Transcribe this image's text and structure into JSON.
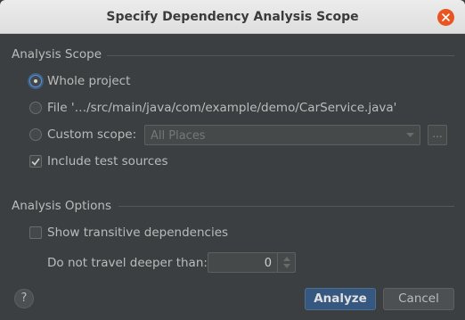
{
  "window": {
    "title": "Specify Dependency Analysis Scope"
  },
  "scope": {
    "heading": "Analysis Scope",
    "whole_project": "Whole project",
    "file": "File '…/src/main/java/com/example/demo/CarService.java'",
    "custom_scope": "Custom scope:",
    "custom_scope_value": "All Places",
    "browse": "...",
    "include_tests": "Include test sources",
    "selected": "whole_project",
    "include_tests_checked": true
  },
  "options": {
    "heading": "Analysis Options",
    "show_transitive": "Show transitive dependencies",
    "show_transitive_checked": false,
    "depth_label": "Do not travel deeper than:",
    "depth_value": "0"
  },
  "buttons": {
    "help": "?",
    "analyze": "Analyze",
    "cancel": "Cancel"
  },
  "colors": {
    "accent": "#365880",
    "close": "#e95420",
    "background": "#3c3f41"
  }
}
